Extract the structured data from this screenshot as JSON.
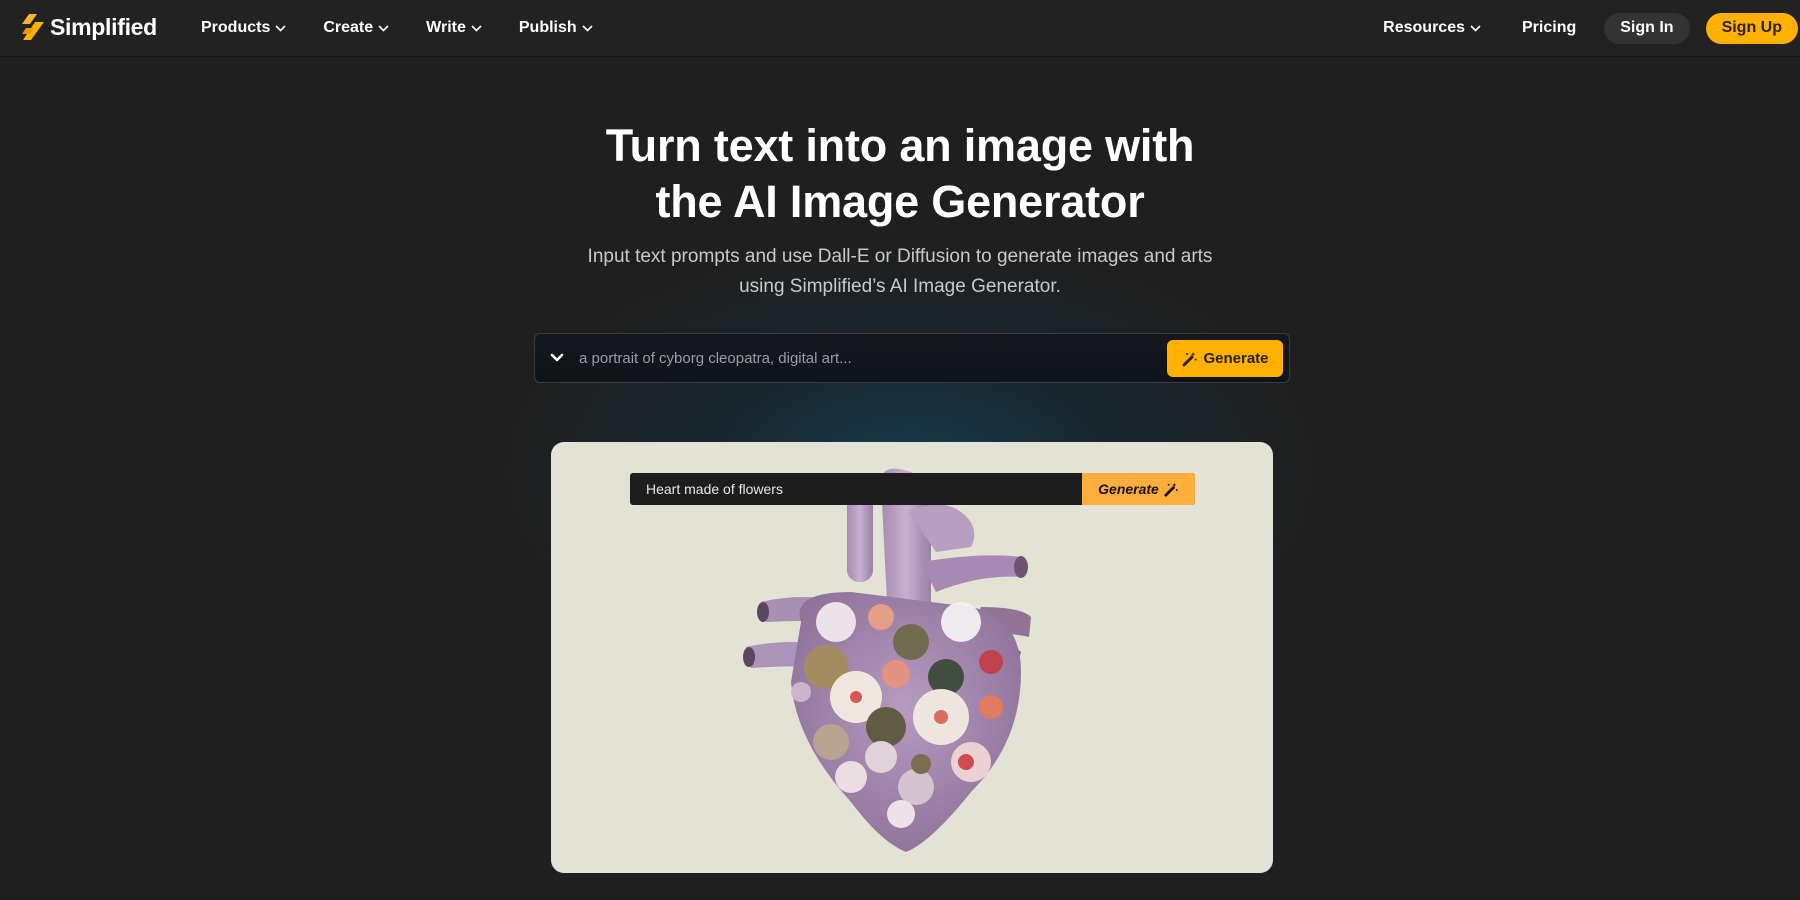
{
  "brand": {
    "name": "Simplified",
    "accent_color": "#ffb000"
  },
  "nav": {
    "left_items": [
      {
        "label": "Products",
        "icon": "chevron-down-icon"
      },
      {
        "label": "Create",
        "icon": "chevron-down-icon"
      },
      {
        "label": "Write",
        "icon": "chevron-down-icon"
      },
      {
        "label": "Publish",
        "icon": "chevron-down-icon"
      }
    ],
    "resources_label": "Resources",
    "pricing_label": "Pricing",
    "signin_label": "Sign In",
    "signup_label": "Sign Up"
  },
  "hero": {
    "title_line1": "Turn text into an image with",
    "title_line2": "the AI Image Generator",
    "subtitle_line1": "Input text prompts and use Dall-E or Diffusion to generate images and arts",
    "subtitle_line2": "using Simplified’s AI Image Generator."
  },
  "prompt": {
    "placeholder": "a portrait of cyborg cleopatra, digital art...",
    "value": "",
    "toggle_icon": "chevron-down-icon",
    "generate_label": "Generate",
    "generate_icon": "magic-wand-icon"
  },
  "showcase": {
    "demo_prompt": "Heart made of flowers",
    "demo_generate_label": "Generate",
    "demo_generate_icon": "magic-wand-icon",
    "image_subject": "anatomical heart covered in flowers",
    "background_color": "#e2e3d4"
  }
}
